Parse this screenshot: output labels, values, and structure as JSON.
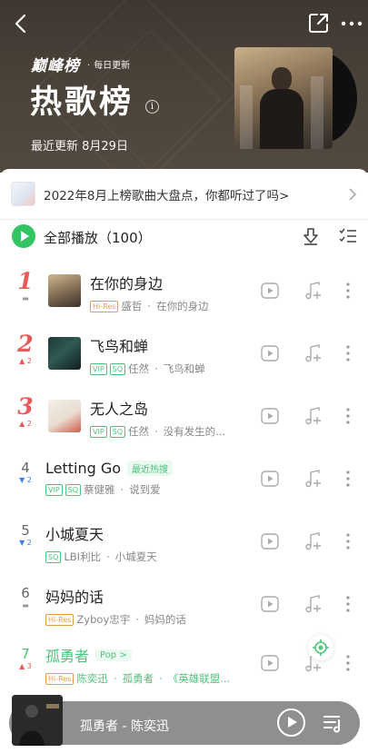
{
  "header": {
    "brand": "巅峰榜",
    "brand_sub": "每日更新",
    "title": "热歌榜",
    "info_glyph": "i",
    "updated": "最近更新 8月29日"
  },
  "banner": {
    "text": "2022年8月上榜歌曲大盘点，你都听过了吗>"
  },
  "play_all": {
    "label": "全部播放（100）"
  },
  "tracks": [
    {
      "rank": "1",
      "change": "▬",
      "title": "在你的身边",
      "tag1": "Hi-Res",
      "artist": "盛哲",
      "album": "在你的身边"
    },
    {
      "rank": "2",
      "change": "▲ 2",
      "title": "飞鸟和蝉",
      "tag1": "VIP",
      "tag2": "SQ",
      "artist": "任然",
      "album": "飞鸟和蝉"
    },
    {
      "rank": "3",
      "change": "▲ 2",
      "title": "无人之岛",
      "tag1": "VIP",
      "tag2": "SQ",
      "artist": "任然",
      "album": "没有发生的..."
    },
    {
      "rank": "4",
      "change": "▼ 2",
      "title": "Letting Go",
      "pill": "最近热搜",
      "tag1": "VIP",
      "tag2": "SQ",
      "artist": "蔡健雅",
      "album": "说到爱"
    },
    {
      "rank": "5",
      "change": "▼ 2",
      "title": "小城夏天",
      "tag1": "SQ",
      "artist": "LBI利比",
      "album": "小城夏天"
    },
    {
      "rank": "6",
      "change": "▬",
      "title": "妈妈的话",
      "tag1": "Hi-Res",
      "artist": "Zyboy忠宇",
      "album": "妈妈的话"
    },
    {
      "rank": "7",
      "change": "▲ 3",
      "title": "孤勇者",
      "pill": "Pop >",
      "tag1": "Hi-Res",
      "artist": "陈奕迅",
      "album": "孤勇者",
      "album2": "《英雄联盟..."
    }
  ],
  "mini_player": {
    "now_playing": "孤勇者 - 陈奕迅"
  },
  "colors": {
    "accent_green": "#33c464",
    "rank_red": "#e95a5a",
    "down_blue": "#3f7fe6",
    "hires_gold": "#e0a14a"
  }
}
